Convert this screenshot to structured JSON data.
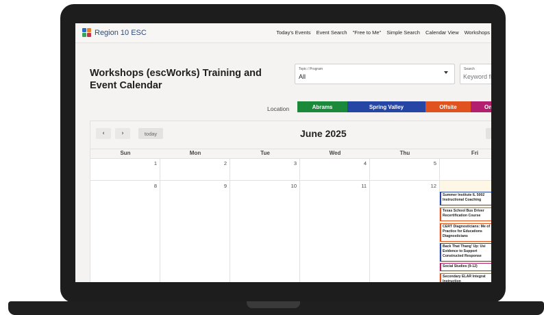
{
  "app": {
    "logo_text": "Region 10 ESC"
  },
  "nav": [
    "Today's Events",
    "Event Search",
    "\"Free to Me\"",
    "Simple Search",
    "Calendar View",
    "Workshops"
  ],
  "page_title": "Workshops (escWorks) Training and Event Calendar",
  "topic_filter": {
    "label": "Topic / Program",
    "value": "All"
  },
  "search": {
    "label": "Search",
    "placeholder": "Keyword fi"
  },
  "location": {
    "label": "Location",
    "tabs": [
      {
        "label": "Abrams",
        "color": "#1a8a3a"
      },
      {
        "label": "Spring Valley",
        "color": "#2546a4"
      },
      {
        "label": "Offsite",
        "color": "#e0531e"
      },
      {
        "label": "On",
        "color": "#b21f6e"
      }
    ]
  },
  "calendar": {
    "month_title": "June 2025",
    "today_label": "today",
    "prev_label": "‹",
    "next_label": "›",
    "day_names": [
      "Sun",
      "Mon",
      "Tue",
      "Wed",
      "Thu",
      "Fri"
    ],
    "weeks": [
      [
        "1",
        "2",
        "3",
        "4",
        "5",
        ""
      ],
      [
        "8",
        "9",
        "10",
        "11",
        "12",
        ""
      ]
    ],
    "events": [
      {
        "title": "Summer Institute IL 5002 Instructional Coaching",
        "color": "#2546a4"
      },
      {
        "title": "Texas School Bus Driver Recertification Course",
        "color": "#e0531e"
      },
      {
        "title": "CERT Diagnosticians: Me of Practice for Educations Diagnosticians",
        "color": "#e0531e"
      },
      {
        "title": "Back That Thang' Up: Usi Evidence to Support Constructed Response",
        "color": "#2546a4"
      },
      {
        "title": "Social Studies (9-12)",
        "color": "#b21f6e"
      },
      {
        "title": "Secondary ELAR Integrat Instruction",
        "color": "#e0531e"
      }
    ]
  },
  "colors": {
    "friday_highlight": "#fff7e5",
    "title_text": "#202020"
  }
}
